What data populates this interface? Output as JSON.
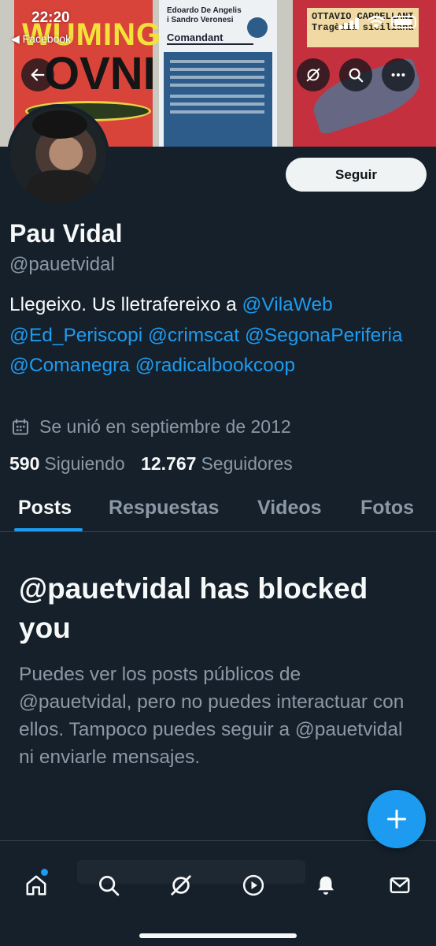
{
  "status_bar": {
    "time": "22:20",
    "back_app": "◀ Facebook"
  },
  "banner": {
    "book1_line1": "WUMING",
    "book1_line2": "OVNI",
    "book2_authors": "Edoardo De Angelis i Sandro Veronesi",
    "book2_title": "Comandant",
    "book3_author": "OTTAVIO CAPPELLANI",
    "book3_title": "Tragèdia siciliana"
  },
  "header_actions": {
    "back_icon": "arrow-left-icon",
    "grok_icon": "slash-circle-icon",
    "search_icon": "search-icon",
    "more_icon": "more-icon"
  },
  "profile": {
    "follow_label": "Seguir",
    "name": "Pau Vidal",
    "handle": "@pauetvidal",
    "bio_text": "Llegeixo. Us lletrafereixo a ",
    "bio_mentions": [
      "@VilaWeb",
      "@Ed_Periscopi",
      "@crimscat",
      "@SegonaPeriferia",
      "@Comanegra",
      "@radicalbookcoop"
    ],
    "joined": "Se unió en septiembre de 2012",
    "following_count": "590",
    "following_label": "Siguiendo",
    "followers_count": "12.767",
    "followers_label": "Seguidores"
  },
  "tabs": [
    "Posts",
    "Respuestas",
    "Videos",
    "Fotos"
  ],
  "blocked": {
    "title": "@pauetvidal has blocked you",
    "description": "Puedes ver los posts públicos de @pauetvidal, pero no puedes interactuar con ellos. Tampoco puedes seguir a @pauetvidal ni enviarle mensajes."
  },
  "colors": {
    "background": "#15202b",
    "accent": "#1d9bf0",
    "text": "#f7f9f9",
    "muted": "#8b98a5"
  },
  "nav_icons": [
    "home-icon",
    "search-icon",
    "grok-icon",
    "video-icon",
    "notifications-icon",
    "messages-icon"
  ]
}
